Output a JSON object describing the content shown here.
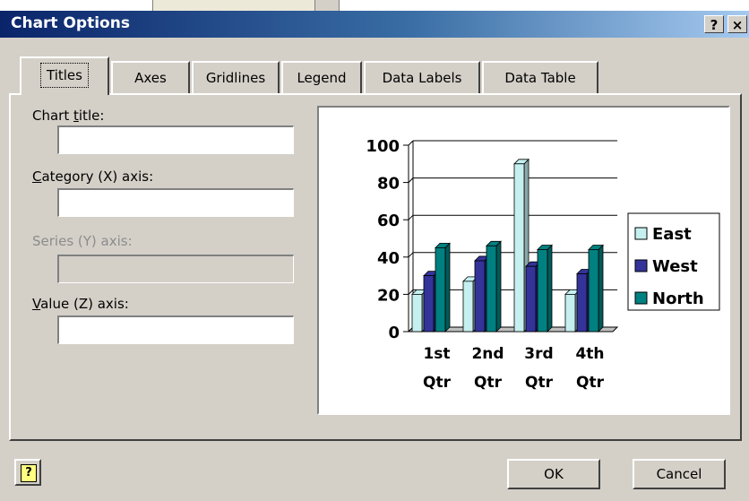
{
  "window": {
    "title": "Chart Options",
    "help_glyph": "?",
    "close_glyph": "×"
  },
  "tabs": [
    {
      "label": "Titles",
      "active": true
    },
    {
      "label": "Axes"
    },
    {
      "label": "Gridlines"
    },
    {
      "label": "Legend"
    },
    {
      "label": "Data Labels"
    },
    {
      "label": "Data Table"
    }
  ],
  "fields": {
    "chart_title": {
      "label_pre": "Chart ",
      "label_u": "t",
      "label_post": "itle:",
      "value": ""
    },
    "category_axis": {
      "label_pre": "",
      "label_u": "C",
      "label_post": "ategory (X) axis:",
      "value": ""
    },
    "series_axis": {
      "label_pre": "Series (Y) axis:",
      "label_u": "",
      "label_post": "",
      "value": "",
      "disabled": true
    },
    "value_axis": {
      "label_pre": "",
      "label_u": "V",
      "label_post": "alue (Z) axis:",
      "value": ""
    }
  },
  "buttons": {
    "ok": "OK",
    "cancel": "Cancel",
    "help_icon": "?"
  },
  "chart_data": {
    "type": "bar",
    "categories": [
      [
        "1st",
        "Qtr"
      ],
      [
        "2nd",
        "Qtr"
      ],
      [
        "3rd",
        "Qtr"
      ],
      [
        "4th",
        "Qtr"
      ]
    ],
    "series": [
      {
        "name": "East",
        "values": [
          20,
          27,
          90,
          20
        ],
        "color": "#c6f0f0"
      },
      {
        "name": "West",
        "values": [
          30,
          38,
          35,
          31
        ],
        "color": "#33339a"
      },
      {
        "name": "North",
        "values": [
          45,
          46,
          44,
          44
        ],
        "color": "#008080"
      }
    ],
    "ylim": [
      0,
      100
    ],
    "yticks": [
      "100",
      "80",
      "60",
      "40",
      "20",
      "0"
    ],
    "grid": true,
    "legend": "right"
  }
}
